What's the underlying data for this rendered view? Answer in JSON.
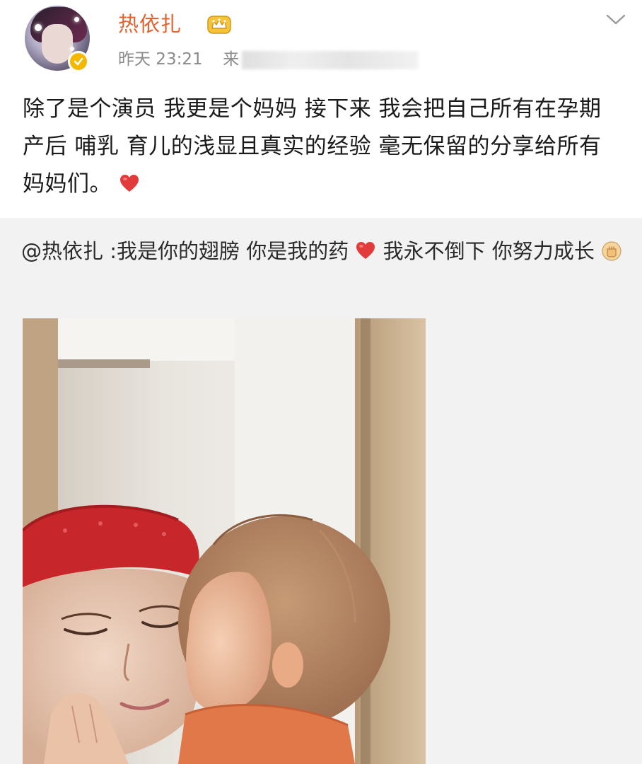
{
  "post": {
    "author": {
      "name": "热依扎",
      "time": "昨天 23:21",
      "source_prefix": "来"
    },
    "text": "除了是个演员 我更是个妈妈 接下来 我会把自己所有在孕期产后 哺乳 育儿的浅显且真实的经验 毫无保留的分享给所有妈妈们。",
    "repost": {
      "mention": "@热依扎",
      "text_a": " :我是你的翅膀 你是我的药",
      "text_b": " 我永不倒下 你努力成长"
    }
  },
  "colors": {
    "username": "#e5622f",
    "meta": "#8a8a8a",
    "repost_bg": "#f2f2f2",
    "heart": "#e23b3b",
    "badge": "#f5b800"
  },
  "icons": {
    "crown": "crown-icon",
    "verified": "verified-badge-icon",
    "chevron": "chevron-down-icon",
    "heart": "heart-icon",
    "fist": "fist-emoji-icon"
  }
}
